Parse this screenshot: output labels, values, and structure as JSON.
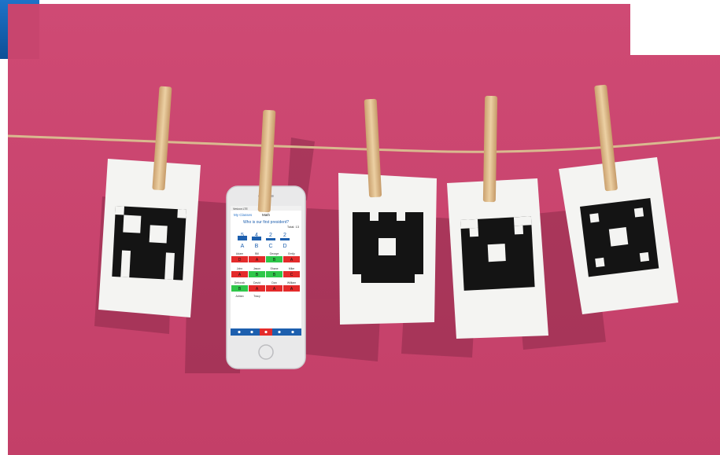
{
  "brand": {
    "accent": "#1565b8",
    "background": "#c8456e"
  },
  "phone": {
    "status_left": "Verizon LTE",
    "nav_back": "My Classes",
    "nav_title": "Math",
    "question": "Who is our first president?",
    "total_label": "Total: 13",
    "results": [
      {
        "choice": "A",
        "count": "5"
      },
      {
        "choice": "B",
        "count": "4"
      },
      {
        "choice": "C",
        "count": "2"
      },
      {
        "choice": "D",
        "count": "2"
      }
    ],
    "students": [
      [
        "Adam",
        "Bill",
        "George",
        "Emily"
      ],
      [
        "John",
        "Jason",
        "Shane",
        "Mike"
      ],
      [
        "Deborah",
        "David",
        "Dan",
        "William"
      ],
      [
        "Adrian",
        "Tracy",
        "",
        ""
      ]
    ],
    "answers": [
      [
        "D",
        "A",
        "B",
        "A"
      ],
      [
        "A",
        "B",
        "B",
        "C"
      ],
      [
        "B",
        "A",
        "A",
        "A"
      ]
    ],
    "toolbar_icons": [
      "list-icon",
      "pen-icon",
      "camera-icon",
      "plus-icon",
      "info-icon"
    ]
  },
  "cards": [
    {
      "name": "card-1",
      "icon": "qr-marker-icon"
    },
    {
      "name": "card-3",
      "icon": "qr-marker-icon"
    },
    {
      "name": "card-4",
      "icon": "qr-marker-icon"
    },
    {
      "name": "card-5",
      "icon": "qr-marker-icon"
    }
  ]
}
